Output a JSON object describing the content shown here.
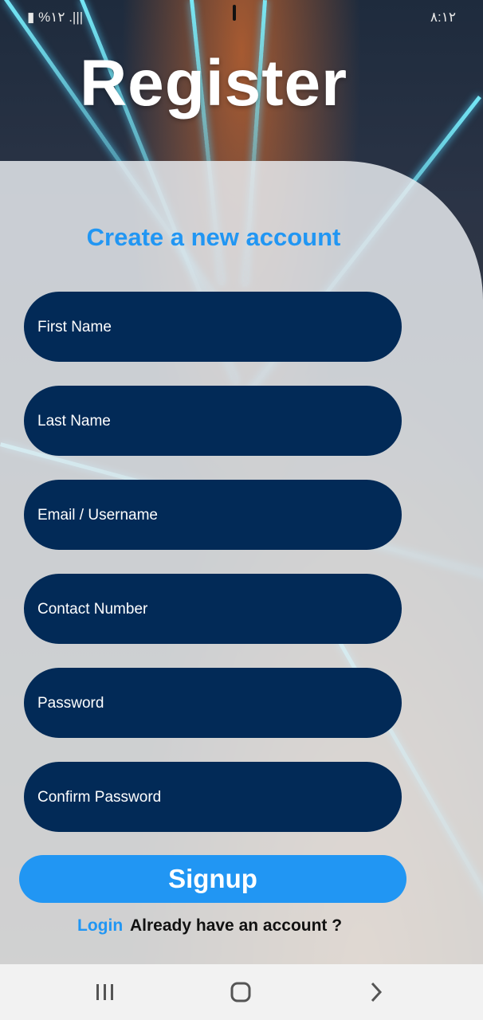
{
  "status_bar": {
    "left": "▮ %١٢ .|||",
    "time": "٨:١٢"
  },
  "page": {
    "title": "Register",
    "subtitle": "Create a new account"
  },
  "form": {
    "fields": [
      {
        "placeholder": "First Name",
        "value": ""
      },
      {
        "placeholder": "Last Name",
        "value": ""
      },
      {
        "placeholder": "Email / Username",
        "value": ""
      },
      {
        "placeholder": "Contact Number",
        "value": ""
      },
      {
        "placeholder": "Password",
        "value": ""
      },
      {
        "placeholder": "Confirm Password",
        "value": ""
      }
    ],
    "signup_label": "Signup",
    "login_link": "Login",
    "already_text": "Already have an account ?"
  },
  "navbar": {
    "icons": [
      "recent-apps-icon",
      "home-icon",
      "back-icon"
    ]
  },
  "colors": {
    "accent": "#2196f3",
    "field_bg": "#022a57",
    "card_bg": "#e8ecf0"
  }
}
